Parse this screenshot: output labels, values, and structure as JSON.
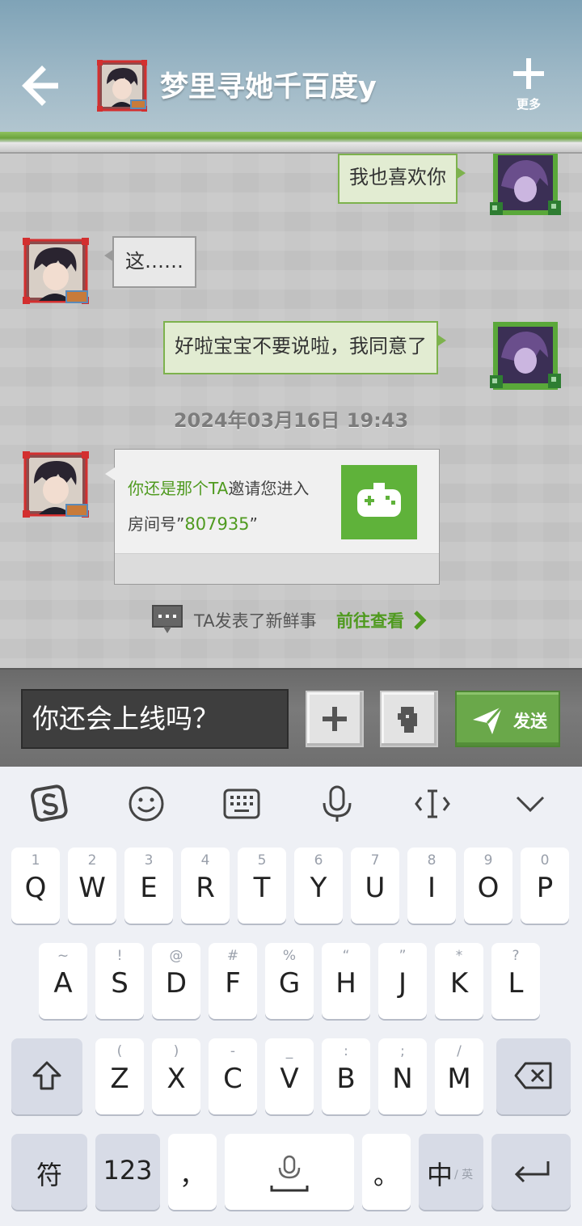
{
  "header": {
    "title": "梦里寻她千百度y",
    "more_label": "更多"
  },
  "messages": [
    {
      "side": "right",
      "text": "我也喜欢你"
    },
    {
      "side": "left",
      "text": "这……"
    },
    {
      "side": "right",
      "text": "好啦宝宝不要说啦，我同意了"
    }
  ],
  "timestamp": "2024年03月16日 19:43",
  "invite": {
    "name": "你还是那个TA",
    "text": "邀请您进入",
    "room_prefix": "房间号”",
    "room_number": "807935",
    "room_suffix": "”"
  },
  "news": {
    "text": "TA发表了新鲜事",
    "link": "前往查看"
  },
  "composer": {
    "input_value": "你还会上线吗？",
    "send_label": "发送"
  },
  "keyboard": {
    "row1": [
      {
        "hint": "1",
        "key": "Q"
      },
      {
        "hint": "2",
        "key": "W"
      },
      {
        "hint": "3",
        "key": "E"
      },
      {
        "hint": "4",
        "key": "R"
      },
      {
        "hint": "5",
        "key": "T"
      },
      {
        "hint": "6",
        "key": "Y"
      },
      {
        "hint": "7",
        "key": "U"
      },
      {
        "hint": "8",
        "key": "I"
      },
      {
        "hint": "9",
        "key": "O"
      },
      {
        "hint": "0",
        "key": "P"
      }
    ],
    "row2": [
      {
        "hint": "~",
        "key": "A"
      },
      {
        "hint": "!",
        "key": "S"
      },
      {
        "hint": "@",
        "key": "D"
      },
      {
        "hint": "#",
        "key": "F"
      },
      {
        "hint": "%",
        "key": "G"
      },
      {
        "hint": "“",
        "key": "H"
      },
      {
        "hint": "”",
        "key": "J"
      },
      {
        "hint": "*",
        "key": "K"
      },
      {
        "hint": "?",
        "key": "L"
      }
    ],
    "row3": [
      {
        "hint": "(",
        "key": "Z"
      },
      {
        "hint": ")",
        "key": "X"
      },
      {
        "hint": "-",
        "key": "C"
      },
      {
        "hint": "_",
        "key": "V"
      },
      {
        "hint": ":",
        "key": "B"
      },
      {
        "hint": ";",
        "key": "N"
      },
      {
        "hint": "/",
        "key": "M"
      }
    ],
    "symbols_label": "符",
    "numbers_label": "123",
    "comma_label": "，",
    "period_label": "。",
    "lang_main": "中",
    "lang_sub": "/ 英"
  }
}
